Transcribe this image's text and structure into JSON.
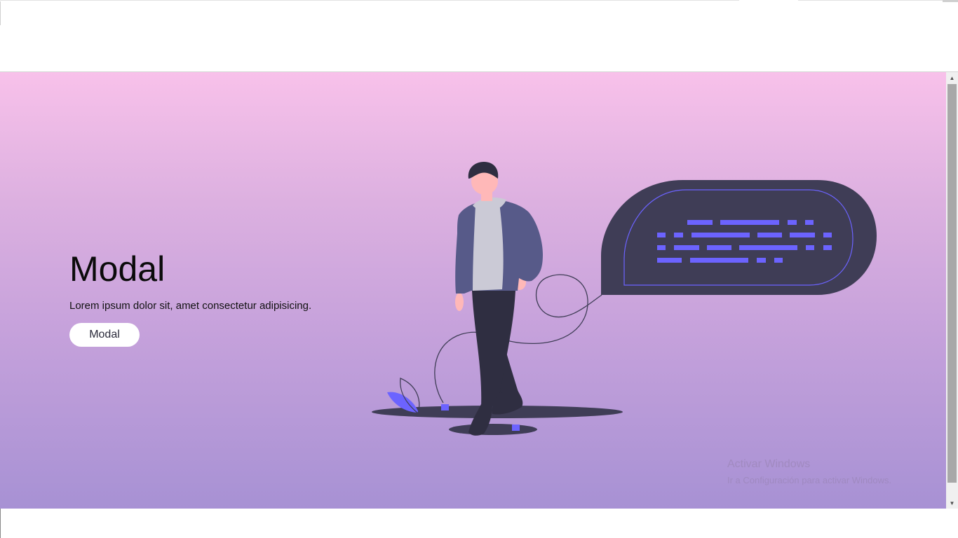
{
  "hero": {
    "title": "Modal",
    "text": "Lorem ipsum dolor sit, amet consectetur adipisicing.",
    "button_label": "Modal"
  },
  "watermark": {
    "title": "Activar Windows",
    "subtitle": "Ir a Configuración para activar Windows."
  },
  "scrollbar": {
    "up_icon": "▲",
    "down_icon": "▼"
  },
  "colors": {
    "gradient_top": "#f8c1ea",
    "gradient_bottom": "#a791d4",
    "accent": "#6c63ff",
    "dark": "#3f3d56"
  }
}
